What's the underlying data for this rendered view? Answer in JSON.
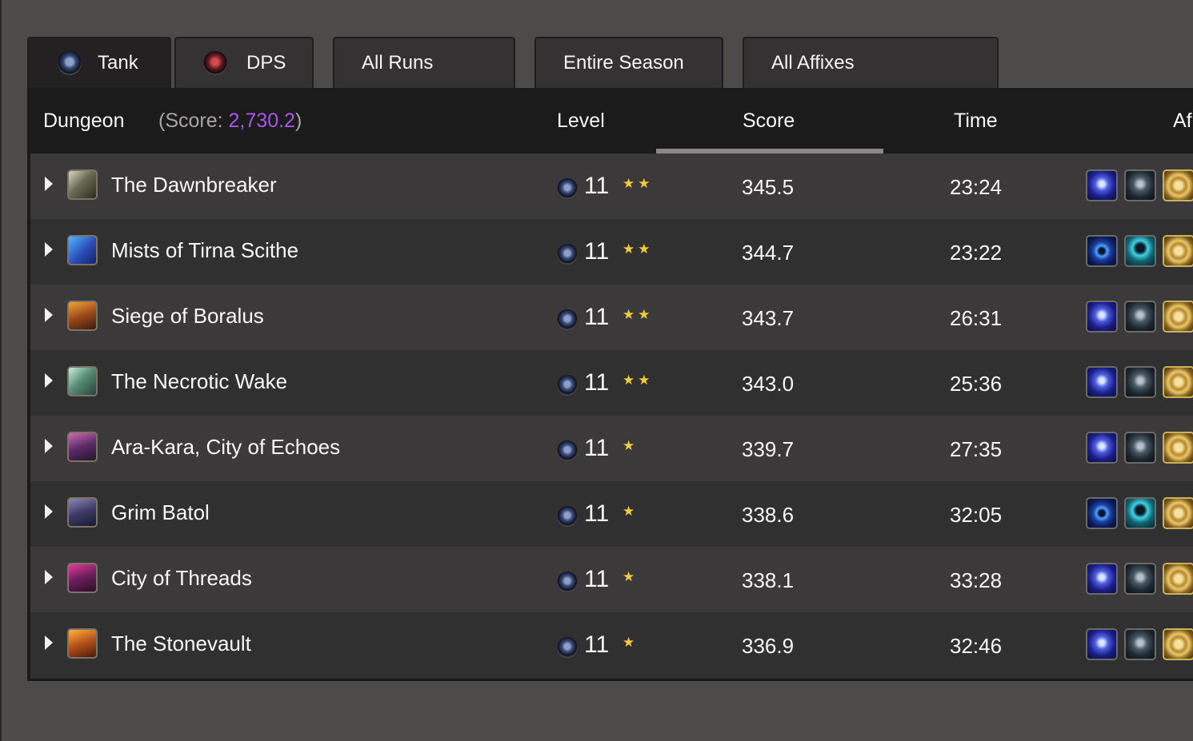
{
  "tabs": [
    {
      "label": "Tank",
      "icon": "tank-role-icon",
      "active": true
    },
    {
      "label": "DPS",
      "icon": "dps-role-icon",
      "active": false
    },
    {
      "label": "All Runs"
    },
    {
      "label": "Entire Season"
    },
    {
      "label": "All Affixes"
    }
  ],
  "table": {
    "headers": {
      "dungeon": "Dungeon",
      "score_prefix": "(Score: ",
      "score_total": "2,730.2",
      "score_suffix": ")",
      "level": "Level",
      "score": "Score",
      "time": "Time",
      "affixes": "Af"
    },
    "sorted_by": "Score",
    "rows": [
      {
        "dungeon": "The Dawnbreaker",
        "icon": "dawnbreaker-icon",
        "level": "11",
        "stars": "★★",
        "score": "345.5",
        "time": "23:24",
        "affixes": [
          "blue-figure-affix-icon",
          "dark-face-affix-icon",
          "gold-seal-affix-icon"
        ]
      },
      {
        "dungeon": "Mists of Tirna Scithe",
        "icon": "mists-icon",
        "level": "11",
        "stars": "★★",
        "score": "344.7",
        "time": "23:22",
        "affixes": [
          "blue-vortex-affix-icon",
          "cyan-figure-affix-icon",
          "gold-seal-affix-icon"
        ]
      },
      {
        "dungeon": "Siege of Boralus",
        "icon": "boralus-icon",
        "level": "11",
        "stars": "★★",
        "score": "343.7",
        "time": "26:31",
        "affixes": [
          "blue-figure-affix-icon",
          "dark-face-affix-icon",
          "gold-seal-affix-icon"
        ]
      },
      {
        "dungeon": "The Necrotic Wake",
        "icon": "necrotic-wake-icon",
        "level": "11",
        "stars": "★★",
        "score": "343.0",
        "time": "25:36",
        "affixes": [
          "blue-figure-affix-icon",
          "dark-face-affix-icon",
          "gold-seal-affix-icon"
        ]
      },
      {
        "dungeon": "Ara-Kara, City of Echoes",
        "icon": "ara-kara-icon",
        "level": "11",
        "stars": "★",
        "score": "339.7",
        "time": "27:35",
        "affixes": [
          "blue-figure-affix-icon",
          "dark-face-affix-icon",
          "gold-seal-affix-icon"
        ]
      },
      {
        "dungeon": "Grim Batol",
        "icon": "grim-batol-icon",
        "level": "11",
        "stars": "★",
        "score": "338.6",
        "time": "32:05",
        "affixes": [
          "blue-vortex-affix-icon",
          "cyan-figure-affix-icon",
          "gold-seal-affix-icon"
        ]
      },
      {
        "dungeon": "City of Threads",
        "icon": "city-of-threads-icon",
        "level": "11",
        "stars": "★",
        "score": "338.1",
        "time": "33:28",
        "affixes": [
          "blue-figure-affix-icon",
          "dark-face-affix-icon",
          "gold-seal-affix-icon"
        ]
      },
      {
        "dungeon": "The Stonevault",
        "icon": "stonevault-icon",
        "level": "11",
        "stars": "★",
        "score": "336.9",
        "time": "32:46",
        "affixes": [
          "blue-figure-affix-icon",
          "dark-face-affix-icon",
          "gold-seal-affix-icon"
        ]
      }
    ]
  },
  "colors": {
    "page_bg": "#4d4a4a",
    "header_bg": "#1c1b1b",
    "score_total": "#a855e8",
    "star": "#f2cc3b"
  }
}
